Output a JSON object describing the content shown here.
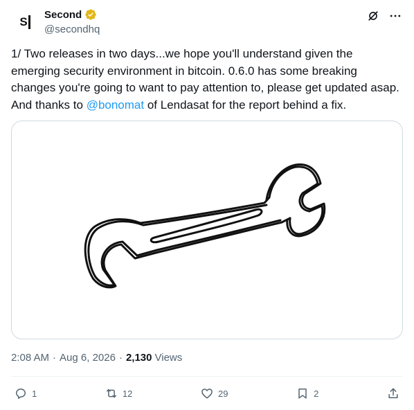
{
  "author": {
    "avatar_text": "S",
    "display_name": "Second",
    "handle": "@secondhq",
    "verified_color": "#e2b719"
  },
  "tweet": {
    "text_before": "1/ Two releases in two days...we hope you'll understand given the emerging security environment in bitcoin. 0.6.0 has some breaking changes you're going to want to pay attention to, please get updated asap. And thanks to ",
    "mention": "@bonomat",
    "text_after": " of Lendasat for the report behind a fix.",
    "mention_color": "#1d9bf0"
  },
  "meta": {
    "time": "2:08 AM",
    "date": "Aug 6, 2026",
    "views_count": "2,130",
    "views_label": "Views"
  },
  "actions": {
    "replies": "1",
    "reposts": "12",
    "likes": "29",
    "bookmarks": "2"
  },
  "icons": {
    "top": [
      "grok-icon",
      "more-icon"
    ],
    "actions": [
      "reply-icon",
      "repost-icon",
      "like-icon",
      "bookmark-icon",
      "share-icon"
    ],
    "media": "wrench-illustration"
  }
}
